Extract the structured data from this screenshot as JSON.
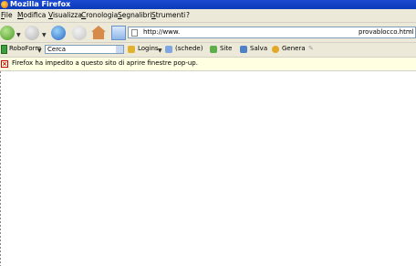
{
  "window": {
    "title": "Mozilla Firefox"
  },
  "menu": {
    "items": [
      "File",
      "Modifica",
      "Visualizza",
      "Cronologia",
      "Segnalibri",
      "Strumenti",
      "?"
    ]
  },
  "navigation": {
    "url_part1": "http://www.",
    "url_part2": "provablocco.html"
  },
  "roboform": {
    "name": "RoboForm",
    "search_value": "Cerca",
    "logins": "Logins",
    "schede": "(schede)",
    "siti": "Site",
    "salva": "Salva",
    "genera": "Genera"
  },
  "infobar": {
    "message": "Firefox ha impedito a questo sito di aprire finestre pop-up."
  },
  "colors": {
    "titlebar": "#0a3bb8",
    "chrome": "#ece9d8",
    "infobar": "#ffffe1"
  }
}
